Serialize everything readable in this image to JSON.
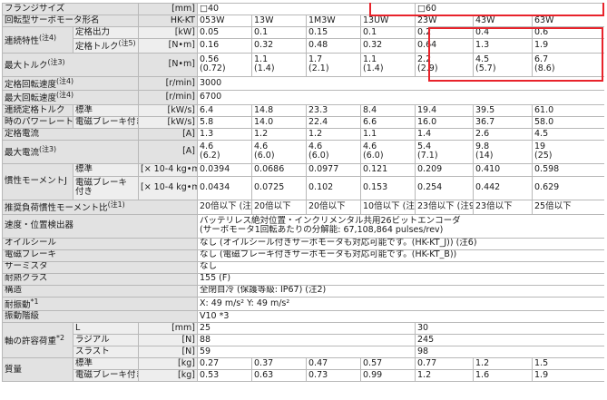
{
  "flange": {
    "label": "フランジサイズ",
    "unit": "[mm]",
    "size_a": "□40",
    "size_b": "□60"
  },
  "model": {
    "label": "回転型サーボモータ形名",
    "prefix": "HK-KT",
    "models": [
      "053W",
      "13W",
      "1M3W",
      "13UW",
      "23W",
      "43W",
      "63W"
    ]
  },
  "continuous": {
    "group": "連続特性",
    "note": "(注4)",
    "output": {
      "label": "定格出力",
      "unit": "[kW]",
      "values": [
        "0.05",
        "0.1",
        "0.15",
        "0.1",
        "0.2",
        "0.4",
        "0.6"
      ]
    },
    "torque": {
      "label": "定格トルク",
      "note": "(注5)",
      "unit": "[N•m]",
      "values": [
        "0.16",
        "0.32",
        "0.48",
        "0.32",
        "0.64",
        "1.3",
        "1.9"
      ]
    }
  },
  "max_torque": {
    "label": "最大トルク",
    "note": "(注3)",
    "unit": "[N•m]",
    "values": [
      "0.56",
      "1.1",
      "1.7",
      "1.1",
      "2.2",
      "4.5",
      "6.7"
    ],
    "sub_values": [
      "(0.72)",
      "(1.4)",
      "(2.1)",
      "(1.4)",
      "(2.9)",
      "(5.7)",
      "(8.6)"
    ]
  },
  "rated_speed": {
    "label": "定格回転速度",
    "note": "(注4)",
    "unit": "[r/min]",
    "value": "3000"
  },
  "max_speed": {
    "label": "最大回転速度",
    "note": "(注4)",
    "unit": "[r/min]",
    "value": "6700"
  },
  "power_rate": {
    "label_line1": "連続定格トルク",
    "label_line2": "時のパワーレート",
    "standard": {
      "label": "標準",
      "unit": "[kW/s]",
      "values": [
        "6.4",
        "14.8",
        "23.3",
        "8.4",
        "19.4",
        "39.5",
        "61.0"
      ]
    },
    "brake": {
      "label": "電磁ブレーキ付き",
      "unit": "[kW/s]",
      "values": [
        "5.8",
        "14.0",
        "22.4",
        "6.6",
        "16.0",
        "36.7",
        "58.0"
      ]
    }
  },
  "rated_current": {
    "label": "定格電流",
    "unit": "[A]",
    "values": [
      "1.3",
      "1.2",
      "1.2",
      "1.1",
      "1.4",
      "2.6",
      "4.5"
    ]
  },
  "max_current": {
    "label": "最大電流",
    "note": "(注3)",
    "unit": "[A]",
    "values": [
      "4.6",
      "4.6",
      "4.6",
      "4.6",
      "5.4",
      "9.8",
      "19"
    ],
    "sub_values": [
      "(6.2)",
      "(6.0)",
      "(6.0)",
      "(6.0)",
      "(7.1)",
      "(14)",
      "(25)"
    ]
  },
  "inertia": {
    "group": "慣性モーメントJ",
    "standard": {
      "label": "標準",
      "unit": "[× 10-4 kg•m²]",
      "values": [
        "0.0394",
        "0.0686",
        "0.0977",
        "0.121",
        "0.209",
        "0.410",
        "0.598"
      ]
    },
    "brake": {
      "label_line1": "電磁ブレーキ",
      "label_line2": "付き",
      "unit": "[× 10-4 kg•m²]",
      "values": [
        "0.0434",
        "0.0725",
        "0.102",
        "0.153",
        "0.254",
        "0.442",
        "0.629"
      ]
    }
  },
  "load_inertia": {
    "label": "推奨負荷慣性モーメント比",
    "note": "(注1)",
    "values": [
      "20倍以下 (注9)",
      "20倍以下",
      "20倍以下",
      "10倍以下 (注9)",
      "23倍以下 (注9)",
      "23倍以下",
      "25倍以下"
    ]
  },
  "encoder": {
    "label": "速度・位置検出器",
    "line1": "バッテリレス絶対位置・インクリメンタル共用26ビットエンコーダ",
    "line2": "(サーボモータ1回転あたりの分解能: 67,108,864 pulses/rev)"
  },
  "oil_seal": {
    "label": "オイルシール",
    "value": "なし (オイルシール付きサーボモータも対応可能です。(HK-KT_J)) (注6)"
  },
  "brake_row": {
    "label": "電磁ブレーキ",
    "value": "なし (電磁ブレーキ付きサーボモータも対応可能です。(HK-KT_B))"
  },
  "thermistor": {
    "label": "サーミスタ",
    "value": "なし"
  },
  "insulation": {
    "label": "耐熱クラス",
    "value": "155 (F)"
  },
  "structure": {
    "label": "構造",
    "value": "全閉自冷 (保護等級: IP67) (注2)"
  },
  "vibration_res": {
    "label": "耐振動",
    "note": "*1",
    "value": "X: 49 m/s² Y: 49 m/s²"
  },
  "vibration_rank": {
    "label": "振動階級",
    "value": "V10 *3"
  },
  "shaft_load": {
    "group": "軸の許容荷重",
    "note": "*2",
    "L": {
      "label": "L",
      "unit": "[mm]",
      "a": "25",
      "b": "30"
    },
    "radial": {
      "label": "ラジアル",
      "unit": "[N]",
      "a": "88",
      "b": "245"
    },
    "thrust": {
      "label": "スラスト",
      "unit": "[N]",
      "a": "59",
      "b": "98"
    }
  },
  "mass": {
    "group": "質量",
    "standard": {
      "label": "標準",
      "unit": "[kg]",
      "values": [
        "0.27",
        "0.37",
        "0.47",
        "0.57",
        "0.77",
        "1.2",
        "1.5"
      ]
    },
    "brake": {
      "label": "電磁ブレーキ付き",
      "unit": "[kg]",
      "values": [
        "0.53",
        "0.63",
        "0.73",
        "0.99",
        "1.2",
        "1.6",
        "1.9"
      ]
    }
  },
  "highlight_color": "#e8232b"
}
